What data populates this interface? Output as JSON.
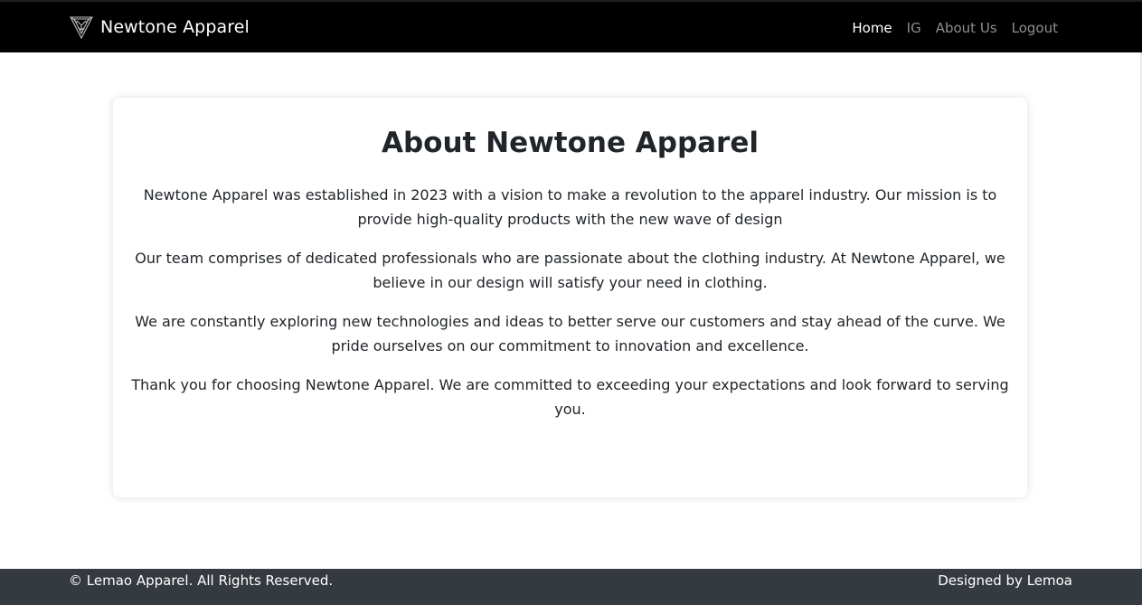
{
  "navbar": {
    "brand_name": "Newtone Apparel",
    "brand_logo_icon": "triangle-emblem-icon",
    "links": [
      {
        "label": "Home",
        "active": true
      },
      {
        "label": "IG",
        "active": false
      },
      {
        "label": "About Us",
        "active": false
      },
      {
        "label": "Logout",
        "active": false
      }
    ]
  },
  "main": {
    "title": "About Newtone Apparel",
    "paragraphs": [
      "Newtone Apparel was established in 2023 with a vision to make a revolution to the apparel industry. Our mission is to provide high-quality products with the new wave of design",
      "Our team comprises of dedicated professionals who are passionate about the clothing industry. At Newtone Apparel, we believe in our design will satisfy your need in clothing.",
      "We are constantly exploring new technologies and ideas to better serve our customers and stay ahead of the curve. We pride ourselves on our commitment to innovation and excellence.",
      "Thank you for choosing Newtone Apparel. We are committed to exceeding your expectations and look forward to serving you."
    ]
  },
  "footer": {
    "copyright": "© Lemao Apparel. All Rights Reserved.",
    "credit": "Designed by Lemoa"
  },
  "colors": {
    "navbar_bg": "#000000",
    "footer_bg": "#343a40",
    "text": "#212529"
  }
}
